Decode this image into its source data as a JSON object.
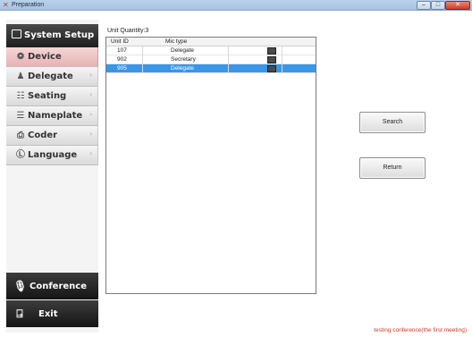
{
  "window": {
    "title": "Preparation",
    "min_glyph": "–",
    "max_glyph": "□",
    "close_glyph": "✕"
  },
  "sidebar": {
    "header": "System Setup",
    "items": [
      {
        "label": "Device",
        "icon": "device-icon",
        "glyph": "⭗",
        "active": true
      },
      {
        "label": "Delegate",
        "icon": "person-icon",
        "glyph": "♟",
        "active": false
      },
      {
        "label": "Seating",
        "icon": "grid-icon",
        "glyph": "☷",
        "active": false
      },
      {
        "label": "Nameplate",
        "icon": "nameplate-icon",
        "glyph": "☰",
        "active": false
      },
      {
        "label": "Coder",
        "icon": "coder-icon",
        "glyph": "⎙",
        "active": false
      },
      {
        "label": "Language",
        "icon": "language-icon",
        "glyph": "Ⓛ",
        "active": false
      }
    ],
    "chevron": "›",
    "conference": "Conference",
    "exit": "Exit"
  },
  "main": {
    "quantity_label": "Unit Quantity:3",
    "columns": [
      "Unit ID",
      "Mic type"
    ],
    "rows": [
      {
        "unit_id": "107",
        "mic_type": "Delegate",
        "selected": false
      },
      {
        "unit_id": "902",
        "mic_type": "Secretary",
        "selected": false
      },
      {
        "unit_id": "905",
        "mic_type": "Delegate",
        "selected": true
      }
    ],
    "search_button": "Search",
    "return_button": "Return"
  },
  "status": "testing conference(the first meeting)",
  "colors": {
    "selection": "#3b96e6",
    "active_nav": "#e6b3b3",
    "status_text": "#d03a2a"
  }
}
